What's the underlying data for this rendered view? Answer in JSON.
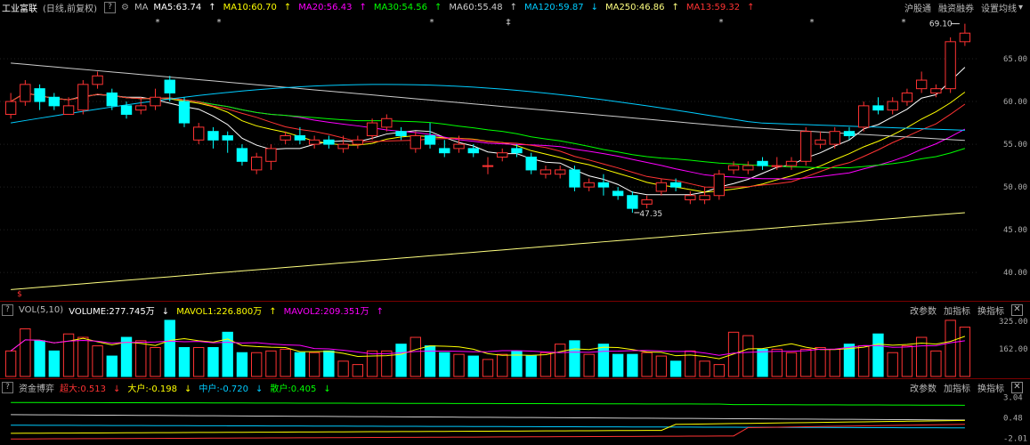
{
  "price_header": {
    "stock_name": "工业富联",
    "mode": "(日线,前复权)",
    "ma_tag": "MA",
    "indicators": [
      {
        "label": "MA5:63.74",
        "arrow": "↑",
        "color": "#ffffff"
      },
      {
        "label": "MA10:60.70",
        "arrow": "↑",
        "color": "#ffff00"
      },
      {
        "label": "MA20:56.43",
        "arrow": "↑",
        "color": "#ff00ff"
      },
      {
        "label": "MA30:54.56",
        "arrow": "↑",
        "color": "#00ff00"
      },
      {
        "label": "MA60:55.48",
        "arrow": "↑",
        "color": "#cccccc"
      },
      {
        "label": "MA120:59.87",
        "arrow": "↓",
        "color": "#00ccff"
      },
      {
        "label": "MA250:46.86",
        "arrow": "↑",
        "color": "#ffff80"
      },
      {
        "label": "MA13:59.32",
        "arrow": "↑",
        "color": "#ff3333"
      }
    ],
    "right_tools": [
      "沪股通",
      "融资融券",
      "设置均线"
    ]
  },
  "price_axis": [
    "65.00",
    "60.00",
    "55.00",
    "50.00",
    "45.00",
    "40.00"
  ],
  "price_annotations": {
    "high": "69.10",
    "low": "47.35",
    "event_marks": [
      "*",
      "*",
      "*",
      "‡",
      "*",
      "*",
      "*"
    ],
    "bottom_mark": "$"
  },
  "vol_header": {
    "title": "VOL(5,10)",
    "items": [
      {
        "label": "VOLUME:277.745万",
        "arrow": "↓",
        "color": "#ffffff"
      },
      {
        "label": "MAVOL1:226.800万",
        "arrow": "↑",
        "color": "#ffff00"
      },
      {
        "label": "MAVOL2:209.351万",
        "arrow": "↑",
        "color": "#ff00ff"
      }
    ],
    "tools": [
      "改参数",
      "加指标",
      "换指标"
    ]
  },
  "vol_axis": [
    "325.00",
    "162.00"
  ],
  "flow_header": {
    "title": "资金博弈",
    "items": [
      {
        "label": "超大:0.513",
        "arrow": "↓",
        "color": "#ff3333"
      },
      {
        "label": "大户:-0.198",
        "arrow": "↓",
        "color": "#ffff00"
      },
      {
        "label": "中户:-0.720",
        "arrow": "↓",
        "color": "#00ccff"
      },
      {
        "label": "散户:0.405",
        "arrow": "↓",
        "color": "#00ff00"
      }
    ],
    "tools": [
      "改参数",
      "加指标",
      "换指标"
    ]
  },
  "flow_axis": [
    "3.04",
    "0.48",
    "-2.01"
  ],
  "chart_data": {
    "type": "candlestick",
    "ylim": [
      37,
      70
    ],
    "candles": [
      [
        58.5,
        60.0,
        61.0,
        58.0
      ],
      [
        60.0,
        62.0,
        62.5,
        59.5
      ],
      [
        61.5,
        60.0,
        62.0,
        59.0
      ],
      [
        60.5,
        59.5,
        61.0,
        59.0
      ],
      [
        58.5,
        59.5,
        60.5,
        58.5
      ],
      [
        59.0,
        62.0,
        62.5,
        58.5
      ],
      [
        62.0,
        63.0,
        63.5,
        61.5
      ],
      [
        61.0,
        59.5,
        61.5,
        59.0
      ],
      [
        59.5,
        58.5,
        60.0,
        58.0
      ],
      [
        59.0,
        59.5,
        60.5,
        58.5
      ],
      [
        59.5,
        60.5,
        61.5,
        59.0
      ],
      [
        62.5,
        61.0,
        63.0,
        60.0
      ],
      [
        60.0,
        57.5,
        60.5,
        57.0
      ],
      [
        55.5,
        57.0,
        57.5,
        55.0
      ],
      [
        56.5,
        55.5,
        57.0,
        54.5
      ],
      [
        56.0,
        55.5,
        56.5,
        54.0
      ],
      [
        54.5,
        53.0,
        55.0,
        52.5
      ],
      [
        52.0,
        53.5,
        54.0,
        51.5
      ],
      [
        53.0,
        54.5,
        55.0,
        52.0
      ],
      [
        55.5,
        56.0,
        56.5,
        55.0
      ],
      [
        56.0,
        55.5,
        57.0,
        55.0
      ],
      [
        55.0,
        55.5,
        56.0,
        54.5
      ],
      [
        55.5,
        55.0,
        56.0,
        54.5
      ],
      [
        54.5,
        55.0,
        56.0,
        54.0
      ],
      [
        55.0,
        55.5,
        56.0,
        54.5
      ],
      [
        56.0,
        57.5,
        58.0,
        55.5
      ],
      [
        57.0,
        58.0,
        58.5,
        56.5
      ],
      [
        56.5,
        56.0,
        57.0,
        55.5
      ],
      [
        54.5,
        56.0,
        56.5,
        54.0
      ],
      [
        56.0,
        55.0,
        57.5,
        54.5
      ],
      [
        54.5,
        54.0,
        55.5,
        53.5
      ],
      [
        54.5,
        55.0,
        56.0,
        54.0
      ],
      [
        54.5,
        54.0,
        55.0,
        53.5
      ],
      [
        52.5,
        52.5,
        53.5,
        51.5
      ],
      [
        53.5,
        54.0,
        54.5,
        53.0
      ],
      [
        54.5,
        54.0,
        55.0,
        53.5
      ],
      [
        53.5,
        52.0,
        54.0,
        51.5
      ],
      [
        51.5,
        52.0,
        52.5,
        51.0
      ],
      [
        51.5,
        52.0,
        52.5,
        51.0
      ],
      [
        52.0,
        50.0,
        52.5,
        49.5
      ],
      [
        50.0,
        50.5,
        51.0,
        49.5
      ],
      [
        50.5,
        50.0,
        51.5,
        49.0
      ],
      [
        49.5,
        49.0,
        50.0,
        48.5
      ],
      [
        49.0,
        47.5,
        49.5,
        47.0
      ],
      [
        48.0,
        48.5,
        49.0,
        47.5
      ],
      [
        49.5,
        50.5,
        51.0,
        49.0
      ],
      [
        50.5,
        50.0,
        51.0,
        49.5
      ],
      [
        48.5,
        49.0,
        49.5,
        48.0
      ],
      [
        48.5,
        49.0,
        50.0,
        48.0
      ],
      [
        49.0,
        51.5,
        52.0,
        48.5
      ],
      [
        52.0,
        52.5,
        53.0,
        51.5
      ],
      [
        52.0,
        52.5,
        53.0,
        51.5
      ],
      [
        53.0,
        52.5,
        53.5,
        52.0
      ],
      [
        52.5,
        52.5,
        53.5,
        52.0
      ],
      [
        52.5,
        53.0,
        53.5,
        52.0
      ],
      [
        53.0,
        56.5,
        57.0,
        52.5
      ],
      [
        55.0,
        55.5,
        56.5,
        54.5
      ],
      [
        55.0,
        56.5,
        57.0,
        54.5
      ],
      [
        56.5,
        56.0,
        57.0,
        55.5
      ],
      [
        57.0,
        59.5,
        60.0,
        56.5
      ],
      [
        59.5,
        59.0,
        60.5,
        58.5
      ],
      [
        59.0,
        60.0,
        60.5,
        58.5
      ],
      [
        60.0,
        61.0,
        61.5,
        59.5
      ],
      [
        61.5,
        62.5,
        63.5,
        61.0
      ],
      [
        61.0,
        61.5,
        62.0,
        60.5
      ],
      [
        61.5,
        67.0,
        67.5,
        61.0
      ],
      [
        67.0,
        68.0,
        69.1,
        66.5
      ]
    ],
    "volume_ylim": [
      0,
      340
    ],
    "volumes": [
      150,
      280,
      210,
      150,
      250,
      230,
      180,
      120,
      230,
      210,
      170,
      330,
      170,
      170,
      170,
      260,
      140,
      140,
      150,
      160,
      140,
      140,
      150,
      90,
      70,
      150,
      150,
      190,
      230,
      180,
      140,
      130,
      120,
      100,
      130,
      150,
      120,
      140,
      190,
      210,
      130,
      190,
      130,
      130,
      140,
      120,
      90,
      150,
      90,
      70,
      260,
      240,
      160,
      160,
      140,
      160,
      170,
      160,
      190,
      180,
      250,
      140,
      180,
      230,
      150,
      330,
      290
    ],
    "flow_ylim": [
      -2.4,
      3.3
    ]
  }
}
